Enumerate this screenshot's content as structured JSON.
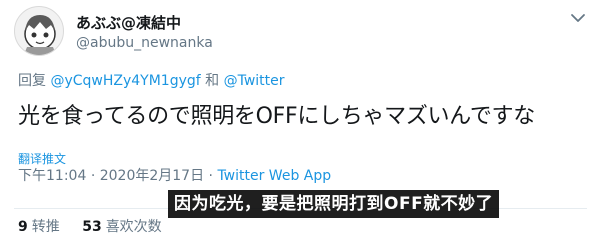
{
  "author": {
    "display_name": "あぶぶ@凍結中",
    "handle": "@abubu_newnanka"
  },
  "reply": {
    "prefix": "回复",
    "to_user": "@yCqwHZy4YM1gygf",
    "conjunction": "和",
    "to_user2": "@Twitter"
  },
  "tweet": {
    "text": "光を食ってるので照明をOFFにしちゃマズいんですな",
    "translate_label": "翻译推文",
    "time": "下午11:04",
    "separator1": "·",
    "date": "2020年2月17日",
    "separator2": "·",
    "source": "Twitter Web App"
  },
  "subtitle": {
    "text": "因为吃光，要是把照明打到OFF就不妙了"
  },
  "stats": {
    "retweet_count": "9",
    "retweet_label": "转推",
    "like_count": "53",
    "like_label": "喜欢次数"
  },
  "colors": {
    "link": "#1b95e0",
    "secondary_text": "#657786",
    "primary_text": "#14171a"
  },
  "icons": {
    "more": "chevron-down-icon",
    "avatar": "avatar-illustration"
  }
}
